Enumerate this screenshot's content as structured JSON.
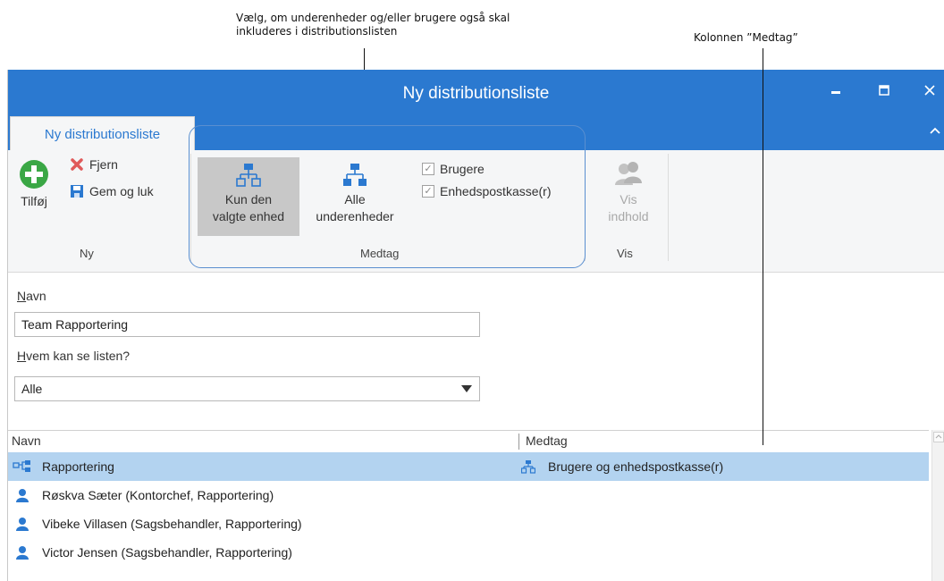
{
  "callouts": {
    "include_line1": "Vælg, om underenheder og/eller brugere også skal",
    "include_line2": "inkluderes i distributionslisten",
    "column": "Kolonnen ”Medtag”"
  },
  "window": {
    "title": "Ny distributionsliste",
    "controls": {
      "minimize": "–",
      "maximize": "■",
      "close": "✕"
    },
    "collapse": "∧"
  },
  "ribbon": {
    "tab": "Ny distributionsliste",
    "ny": {
      "add_label": "Tilføj",
      "remove_label": "Fjern",
      "save_close_label": "Gem og luk",
      "group": "Ny"
    },
    "medtag": {
      "selected_unit_line1": "Kun den",
      "selected_unit_line2": "valgte enhed",
      "all_sub_line1": "Alle",
      "all_sub_line2": "underenheder",
      "users_label": "Brugere",
      "users_checked": true,
      "unit_mailbox_label": "Enhedspostkasse(r)",
      "unit_mailbox_checked": true,
      "group": "Medtag"
    },
    "vis": {
      "show_content_line1": "Vis",
      "show_content_line2": "indhold",
      "group": "Vis"
    }
  },
  "form": {
    "name_label_key": "N",
    "name_label_rest": "avn",
    "name_value": "Team Rapportering",
    "visibility_label_key": "H",
    "visibility_label_rest": "vem kan se listen?",
    "visibility_value": "Alle"
  },
  "list": {
    "columns": {
      "name": "Navn",
      "medtag": "Medtag"
    },
    "rows": [
      {
        "name": "Rapportering",
        "medtag": "Brugere og enhedspostkasse(r)",
        "type": "unit",
        "selected": true
      },
      {
        "name": "Røskva Sæter (Kontorchef, Rapportering)",
        "medtag": "",
        "type": "user",
        "selected": false
      },
      {
        "name": "Vibeke Villasen (Sagsbehandler, Rapportering)",
        "medtag": "",
        "type": "user",
        "selected": false
      },
      {
        "name": "Victor Jensen (Sagsbehandler, Rapportering)",
        "medtag": "",
        "type": "user",
        "selected": false
      }
    ]
  },
  "colors": {
    "accent": "#2b79d0",
    "selection": "#b3d3f0",
    "add_green": "#3aa745",
    "remove_red": "#e05a5a"
  },
  "icons": [
    "plus-circle-icon",
    "x-icon",
    "save-icon",
    "org-chart-icon",
    "users-icon",
    "person-icon",
    "unit-tree-icon"
  ]
}
